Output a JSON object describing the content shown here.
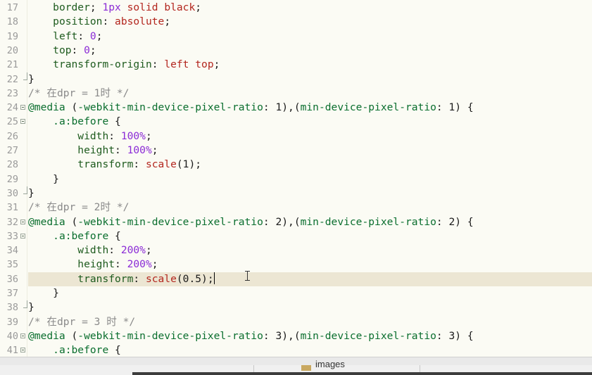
{
  "editor": {
    "lines": [
      {
        "num": "17",
        "fold": "",
        "tokens": [
          [
            "",
            "    "
          ],
          [
            "p",
            "border"
          ],
          [
            "",
            "; "
          ],
          [
            "n",
            "1px"
          ],
          [
            "",
            ""
          ],
          [
            "v",
            " solid black"
          ],
          [
            "",
            ";"
          ]
        ]
      },
      {
        "num": "18",
        "fold": "",
        "tokens": [
          [
            "",
            "    "
          ],
          [
            "p",
            "position"
          ],
          [
            "",
            ": "
          ],
          [
            "v",
            "absolute"
          ],
          [
            "",
            ";"
          ]
        ]
      },
      {
        "num": "19",
        "fold": "",
        "tokens": [
          [
            "",
            "    "
          ],
          [
            "p",
            "left"
          ],
          [
            "",
            ": "
          ],
          [
            "n",
            "0"
          ],
          [
            "",
            ";"
          ]
        ]
      },
      {
        "num": "20",
        "fold": "",
        "tokens": [
          [
            "",
            "    "
          ],
          [
            "p",
            "top"
          ],
          [
            "",
            ": "
          ],
          [
            "n",
            "0"
          ],
          [
            "",
            ";"
          ]
        ]
      },
      {
        "num": "21",
        "fold": "",
        "tokens": [
          [
            "",
            "    "
          ],
          [
            "p",
            "transform-origin"
          ],
          [
            "",
            ": "
          ],
          [
            "v",
            "left top"
          ],
          [
            "",
            ";"
          ]
        ]
      },
      {
        "num": "22",
        "fold": "end",
        "tokens": [
          [
            "",
            "}"
          ]
        ]
      },
      {
        "num": "23",
        "fold": "",
        "tokens": [
          [
            "c",
            "/* 在dpr = 1时 */"
          ]
        ]
      },
      {
        "num": "24",
        "fold": "open",
        "tokens": [
          [
            "s",
            "@media"
          ],
          [
            "",
            " ("
          ],
          [
            "s",
            "-webkit-min-device-pixel-ratio"
          ],
          [
            "",
            ": 1),("
          ],
          [
            "s",
            "min-device-pixel-ratio"
          ],
          [
            "",
            ": 1) {"
          ]
        ]
      },
      {
        "num": "25",
        "fold": "open",
        "tokens": [
          [
            "",
            "    "
          ],
          [
            "s",
            ".a:before"
          ],
          [
            "",
            " {"
          ]
        ]
      },
      {
        "num": "26",
        "fold": "",
        "tokens": [
          [
            "",
            "        "
          ],
          [
            "p",
            "width"
          ],
          [
            "",
            ": "
          ],
          [
            "n",
            "100%"
          ],
          [
            "",
            ";"
          ]
        ]
      },
      {
        "num": "27",
        "fold": "",
        "tokens": [
          [
            "",
            "        "
          ],
          [
            "p",
            "height"
          ],
          [
            "",
            ": "
          ],
          [
            "n",
            "100%"
          ],
          [
            "",
            ";"
          ]
        ]
      },
      {
        "num": "28",
        "fold": "",
        "tokens": [
          [
            "",
            "        "
          ],
          [
            "p",
            "transform"
          ],
          [
            "",
            ": "
          ],
          [
            "v",
            "scale"
          ],
          [
            "",
            "(1);"
          ]
        ]
      },
      {
        "num": "29",
        "fold": "",
        "tokens": [
          [
            "",
            "    }"
          ]
        ]
      },
      {
        "num": "30",
        "fold": "end",
        "tokens": [
          [
            "",
            "}"
          ]
        ]
      },
      {
        "num": "31",
        "fold": "",
        "tokens": [
          [
            "c",
            "/* 在dpr = 2时 */"
          ]
        ]
      },
      {
        "num": "32",
        "fold": "open",
        "tokens": [
          [
            "s",
            "@media"
          ],
          [
            "",
            " ("
          ],
          [
            "s",
            "-webkit-min-device-pixel-ratio"
          ],
          [
            "",
            ": 2),("
          ],
          [
            "s",
            "min-device-pixel-ratio"
          ],
          [
            "",
            ": 2) {"
          ]
        ]
      },
      {
        "num": "33",
        "fold": "open",
        "tokens": [
          [
            "",
            "    "
          ],
          [
            "s",
            ".a:before"
          ],
          [
            "",
            " {"
          ]
        ]
      },
      {
        "num": "34",
        "fold": "",
        "tokens": [
          [
            "",
            "        "
          ],
          [
            "p",
            "width"
          ],
          [
            "",
            ": "
          ],
          [
            "n",
            "200%"
          ],
          [
            "",
            ";"
          ]
        ]
      },
      {
        "num": "35",
        "fold": "",
        "tokens": [
          [
            "",
            "        "
          ],
          [
            "p",
            "height"
          ],
          [
            "",
            ": "
          ],
          [
            "n",
            "200%"
          ],
          [
            "",
            ";"
          ]
        ]
      },
      {
        "num": "36",
        "fold": "",
        "current": true,
        "tokens": [
          [
            "",
            "        "
          ],
          [
            "p",
            "transform"
          ],
          [
            "",
            ": "
          ],
          [
            "v",
            "scale"
          ],
          [
            "",
            "(0.5);"
          ]
        ]
      },
      {
        "num": "37",
        "fold": "",
        "tokens": [
          [
            "",
            "    }"
          ]
        ]
      },
      {
        "num": "38",
        "fold": "end",
        "tokens": [
          [
            "",
            "}"
          ]
        ]
      },
      {
        "num": "39",
        "fold": "",
        "tokens": [
          [
            "c",
            "/* 在dpr = 3 时 */"
          ]
        ]
      },
      {
        "num": "40",
        "fold": "open",
        "tokens": [
          [
            "s",
            "@media"
          ],
          [
            "",
            " ("
          ],
          [
            "s",
            "-webkit-min-device-pixel-ratio"
          ],
          [
            "",
            ": 3),("
          ],
          [
            "s",
            "min-device-pixel-ratio"
          ],
          [
            "",
            ": 3) {"
          ]
        ]
      },
      {
        "num": "41",
        "fold": "open",
        "tokens": [
          [
            "",
            "    "
          ],
          [
            "s",
            ".a:before"
          ],
          [
            "",
            " {"
          ]
        ]
      }
    ]
  },
  "bottom_panel": {
    "tree_item_label": "images",
    "tree_item_icon": "folder-icon"
  },
  "colors": {
    "background": "#fbfbf4",
    "current_line": "#ece6d3",
    "property": "#1e5b1e",
    "value": "#b3261e",
    "number": "#8b2bd6",
    "selector": "#0a6e2e",
    "comment": "#8a8a8a"
  }
}
